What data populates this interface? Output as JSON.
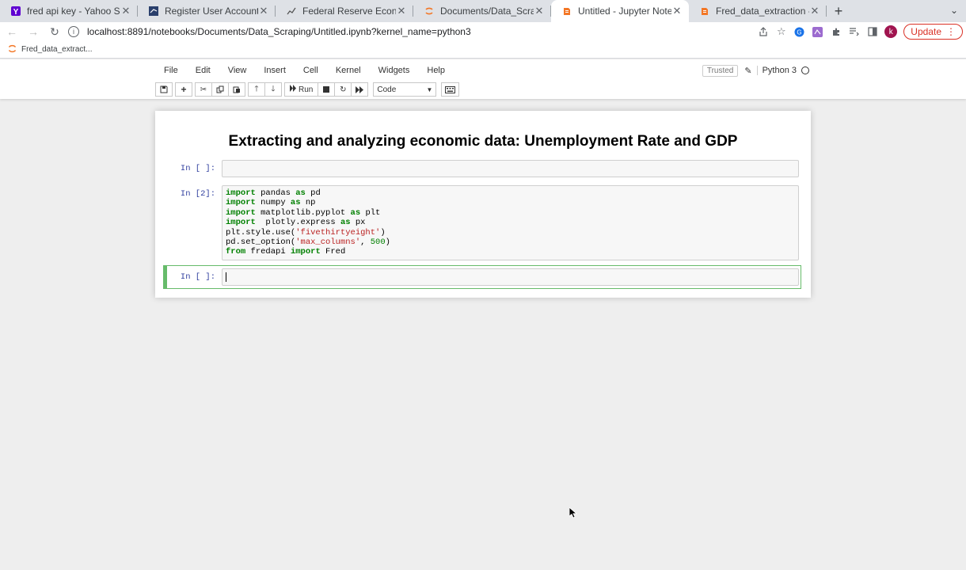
{
  "browser": {
    "tabs": [
      {
        "title": "fred api key - Yahoo Search Re",
        "favicon": "yahoo-icon",
        "active": false
      },
      {
        "title": "Register User Account - St. Lo",
        "favicon": "fred-flag-icon",
        "active": false
      },
      {
        "title": "Federal Reserve Economic Dat",
        "favicon": "fred-chart-icon",
        "active": false
      },
      {
        "title": "Documents/Data_Scraping/",
        "favicon": "jupyter-icon",
        "active": false
      },
      {
        "title": "Untitled - Jupyter Notebook",
        "favicon": "jupyter-notebook-icon",
        "active": true
      },
      {
        "title": "Fred_data_extraction - Jupyte",
        "favicon": "jupyter-notebook-icon",
        "active": false
      }
    ],
    "url": "localhost:8891/notebooks/Documents/Data_Scraping/Untitled.ipynb?kernel_name=python3",
    "update_label": "Update",
    "avatar_letter": "k",
    "bookmark": "Fred_data_extract..."
  },
  "jupyter": {
    "menu": [
      "File",
      "Edit",
      "View",
      "Insert",
      "Cell",
      "Kernel",
      "Widgets",
      "Help"
    ],
    "trusted": "Trusted",
    "kernel": "Python 3",
    "run_label": "Run",
    "cell_type": "Code"
  },
  "notebook": {
    "title": "Extracting and analyzing economic data: Unemployment Rate and GDP",
    "cells": [
      {
        "prompt": "In [ ]:"
      },
      {
        "prompt": "In [2]:"
      },
      {
        "prompt": "In [ ]:"
      }
    ]
  },
  "colors": {
    "keyword": "#008000",
    "string": "#ba2121",
    "prompt": "#303f9f",
    "selected_cell": "#66bb6a",
    "update_red": "#d93025"
  }
}
